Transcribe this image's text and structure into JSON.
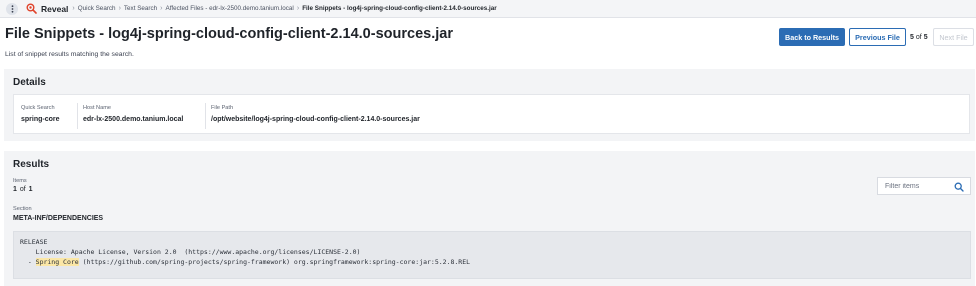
{
  "topbar": {
    "app_name": "Reveal",
    "breadcrumbs": [
      "Quick Search",
      "Text Search",
      "Affected Files - edr-lx-2500.demo.tanium.local",
      "File Snippets - log4j-spring-cloud-config-client-2.14.0-sources.jar"
    ],
    "separator": "›"
  },
  "header": {
    "title": "File Snippets - log4j-spring-cloud-config-client-2.14.0-sources.jar",
    "subtitle": "List of snippet results matching the search.",
    "back_label": "Back to Results",
    "prev_label": "Previous File",
    "pager_current": "5",
    "pager_of": "of",
    "pager_total": "5",
    "next_label": "Next File"
  },
  "details": {
    "title": "Details",
    "fields": [
      {
        "label": "Quick Search",
        "value": "spring-core"
      },
      {
        "label": "Host Name",
        "value": "edr-lx-2500.demo.tanium.local"
      },
      {
        "label": "File Path",
        "value": "/opt/website/log4j-spring-cloud-config-client-2.14.0-sources.jar"
      }
    ]
  },
  "results": {
    "title": "Results",
    "items_label": "Items",
    "items_current": "1",
    "items_of": "of",
    "items_total": "1",
    "filter_placeholder": "Filter items",
    "section_label": "Section",
    "section_value": "META-INF/DEPENDENCIES",
    "snippet": {
      "line1": "RELEASE",
      "line2": "    License: Apache License, Version 2.0  (https://www.apache.org/licenses/LICENSE-2.0)",
      "line3_prefix": "  - ",
      "line3_highlight": "Spring Core",
      "line3_suffix": " (https://github.com/spring-projects/spring-framework) org.springframework:spring-core:jar:5.2.8.REL"
    }
  },
  "colors": {
    "accent": "#2b6cb4",
    "highlight": "#fbe7a6",
    "reveal_icon": "#e0432b"
  },
  "icons": {
    "menu": "vertical-dots-icon",
    "app": "magnifier-reveal-icon",
    "search": "search-icon"
  }
}
